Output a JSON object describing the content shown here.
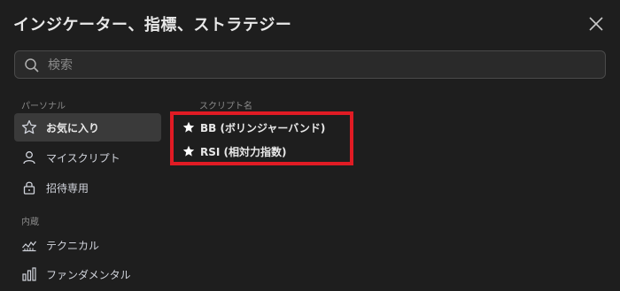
{
  "dialog": {
    "title": "インジケーター、指標、ストラテジー",
    "close_icon": "close-icon"
  },
  "search": {
    "placeholder": "検索",
    "value": "",
    "icon": "search-icon"
  },
  "sidebar": {
    "personal_label": "パーソナル",
    "builtin_label": "内蔵",
    "items": [
      {
        "label": "お気に入り",
        "icon": "star-outline-icon",
        "active": true
      },
      {
        "label": "マイスクリプト",
        "icon": "user-icon",
        "active": false
      },
      {
        "label": "招待専用",
        "icon": "lock-icon",
        "active": false
      },
      {
        "label": "テクニカル",
        "icon": "technical-chart-icon",
        "active": false
      },
      {
        "label": "ファンダメンタル",
        "icon": "bar-chart-icon",
        "active": false
      }
    ]
  },
  "main": {
    "column_header": "スクリプト名",
    "scripts": [
      {
        "label": "BB (ボリンジャーバンド)",
        "icon": "star-filled-icon"
      },
      {
        "label": "RSI (相対力指数)",
        "icon": "star-filled-icon"
      }
    ]
  },
  "colors": {
    "background": "#1e1e1e",
    "active_item": "#3a3a3a",
    "highlight": "#e01b24",
    "text": "#d1d4dc"
  }
}
